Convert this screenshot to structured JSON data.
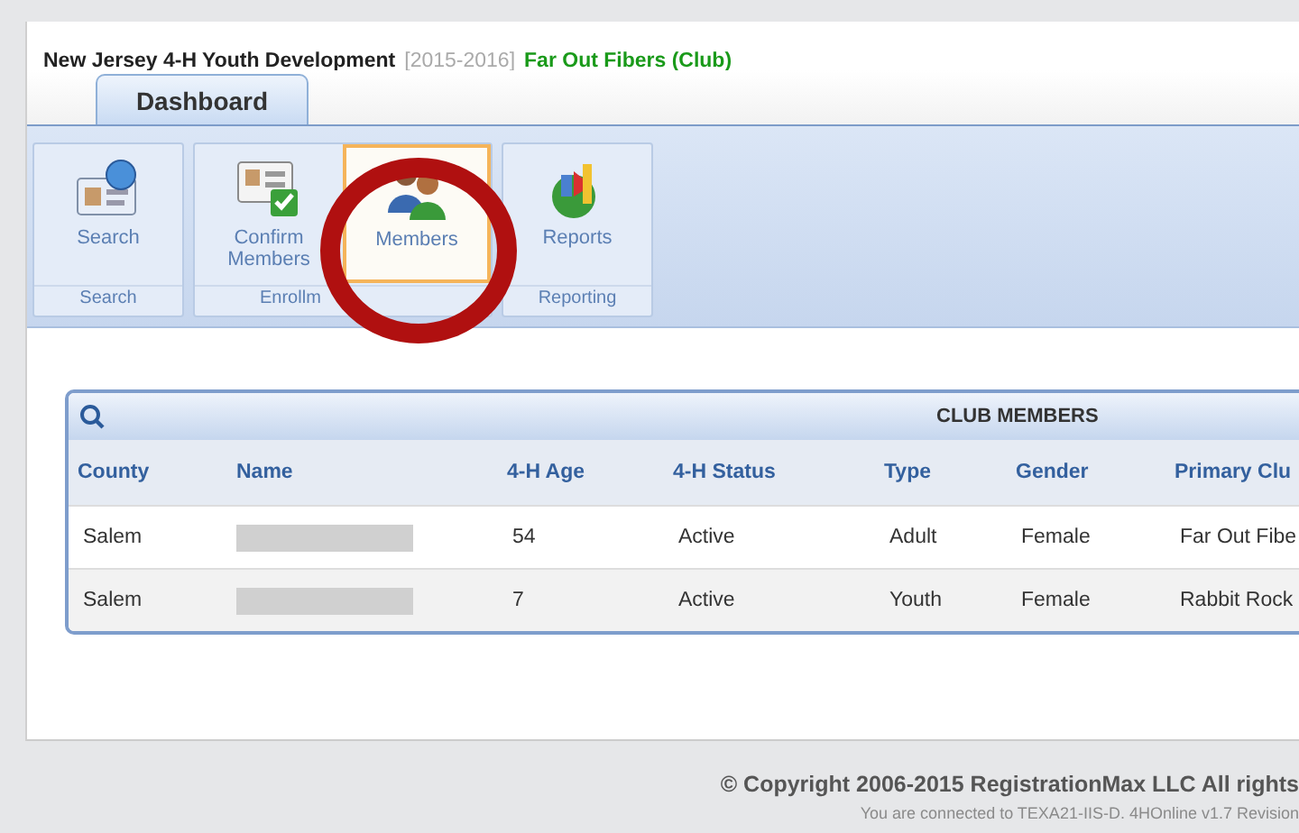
{
  "header": {
    "org": "New Jersey 4-H Youth Development",
    "year": "[2015-2016]",
    "club": "Far Out Fibers (Club)"
  },
  "tabs": [
    {
      "label": "Dashboard",
      "selected": true
    }
  ],
  "ribbon_groups": [
    {
      "label": "Search",
      "buttons": [
        {
          "label": "Search",
          "kind": "search",
          "selected": false
        }
      ]
    },
    {
      "label": "Enrollm",
      "buttons": [
        {
          "label": "Confirm Members",
          "kind": "confirm",
          "selected": false
        },
        {
          "label": "Members",
          "kind": "members",
          "selected": true
        }
      ]
    },
    {
      "label": "Reporting",
      "buttons": [
        {
          "label": "Reports",
          "kind": "reports",
          "selected": false
        }
      ]
    }
  ],
  "annotation": {
    "kind": "circle"
  },
  "table": {
    "title": "CLUB MEMBERS",
    "columns": [
      "County",
      "Name",
      "4-H Age",
      "4-H Status",
      "Type",
      "Gender",
      "Primary Clu"
    ],
    "rows": [
      {
        "county": "Salem",
        "age": "54",
        "status": "Active",
        "type": "Adult",
        "gender": "Female",
        "club": "Far Out Fibe"
      },
      {
        "county": "Salem",
        "age": "7",
        "status": "Active",
        "type": "Youth",
        "gender": "Female",
        "club": "Rabbit Rock"
      }
    ]
  },
  "footer": {
    "copyright": "© Copyright 2006-2015 RegistrationMax LLC All rights",
    "connection": "You are connected to TEXA21-IIS-D. 4HOnline v1.7 Revision"
  }
}
